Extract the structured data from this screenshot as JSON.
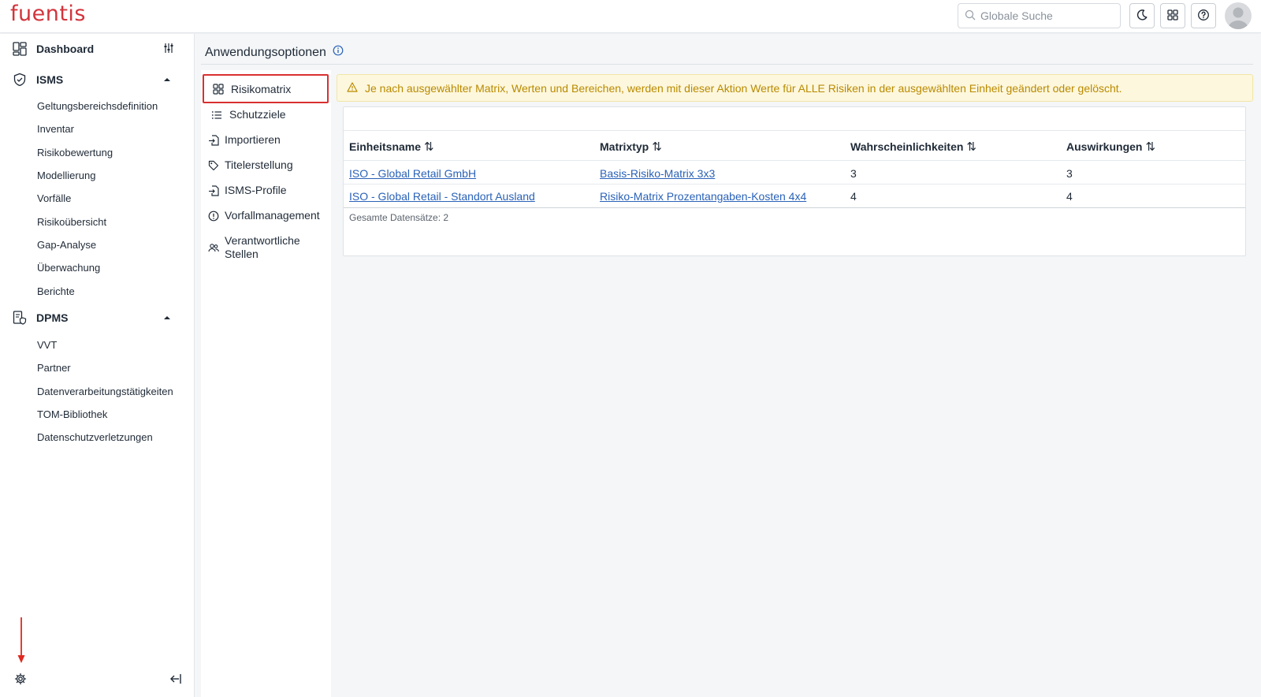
{
  "header": {
    "logo": "fuentis",
    "search_placeholder": "Globale Suche"
  },
  "sidebar": {
    "dashboard": "Dashboard",
    "isms": {
      "label": "ISMS",
      "items": [
        "Geltungsbereichsdefinition",
        "Inventar",
        "Risikobewertung",
        "Modellierung",
        "Vorfälle",
        "Risikoübersicht",
        "Gap-Analyse",
        "Überwachung",
        "Berichte"
      ]
    },
    "dpms": {
      "label": "DPMS",
      "items": [
        "VVT",
        "Partner",
        "Datenverarbeitungstätigkeiten",
        "TOM-Bibliothek",
        "Datenschutzverletzungen"
      ]
    }
  },
  "main": {
    "title": "Anwendungsoptionen",
    "submenu": {
      "risikomatrix": "Risikomatrix",
      "schutzziele": "Schutzziele",
      "importieren": "Importieren",
      "titelerstellung": "Titelerstellung",
      "isms_profile": "ISMS-Profile",
      "vorfallmanagement": "Vorfallmanagement",
      "verantwortliche_1": "Verantwortliche",
      "verantwortliche_2": "Stellen"
    },
    "warning": "Je nach ausgewählter Matrix, Werten und Bereichen, werden mit dieser Aktion Werte für ALLE Risiken in der ausgewählten Einheit geändert oder gelöscht.",
    "table": {
      "columns": [
        "Einheitsname",
        "Matrixtyp",
        "Wahrscheinlichkeiten",
        "Auswirkungen"
      ],
      "sort_glyph": "⇅",
      "rows": [
        {
          "einheit": "ISO - Global Retail GmbH",
          "matrix": "Basis-Risiko-Matrix 3x3",
          "wahr": "3",
          "ausw": "3"
        },
        {
          "einheit": "ISO - Global Retail - Standort Ausland",
          "matrix": "Risiko-Matrix Prozentangaben-Kosten 4x4",
          "wahr": "4",
          "ausw": "4"
        }
      ],
      "footer": "Gesamte Datensätze: 2"
    }
  },
  "colors": {
    "brand": "#d2343c",
    "link": "#2a62b8",
    "warning_text": "#b98a00",
    "warning_bg": "#fdf7dd",
    "highlight": "#d93030"
  }
}
